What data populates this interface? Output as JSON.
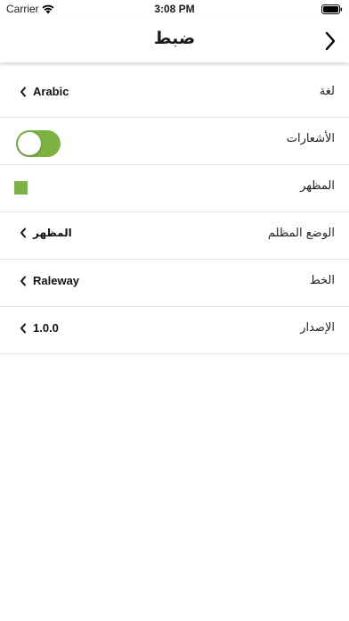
{
  "status_bar": {
    "carrier": "Carrier",
    "time": "3:08 PM",
    "wifi_icon": "wifi-icon",
    "battery_icon": "battery-icon"
  },
  "nav": {
    "title": "ضبط",
    "back_icon": "chevron-right-icon"
  },
  "colors": {
    "accent": "#7cb342",
    "divider": "#e3e3e3"
  },
  "settings": {
    "language": {
      "label": "لغة",
      "value": "Arabic"
    },
    "notifications": {
      "label": "الأشعارات",
      "enabled": true
    },
    "appearance": {
      "label": "المظهر",
      "color": "#7cb342"
    },
    "dark_mode": {
      "label": "الوضع المظلم",
      "value": "المظهر"
    },
    "font": {
      "label": "الخط",
      "value": "Raleway"
    },
    "version": {
      "label": "الإصدار",
      "value": "1.0.0"
    }
  }
}
